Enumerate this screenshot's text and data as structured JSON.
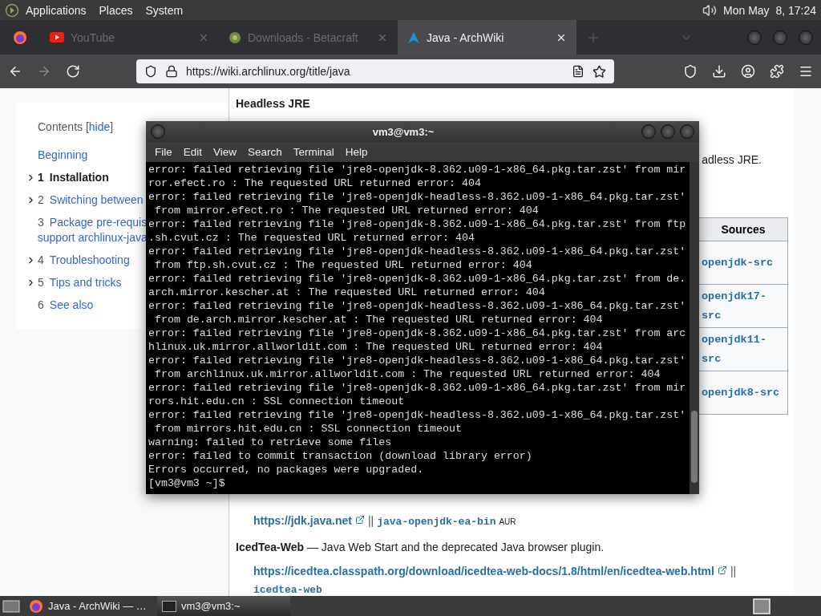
{
  "top_panel": {
    "menus": [
      "Applications",
      "Places",
      "System"
    ],
    "clock": "Mon May  8, 17:24"
  },
  "browser": {
    "tabs": [
      {
        "title": "YouTube",
        "kind": "youtube",
        "selected": false
      },
      {
        "title": "Downloads - Betacraft",
        "kind": "betacraft",
        "selected": false
      },
      {
        "title": "Java - ArchWiki",
        "kind": "arch",
        "selected": true
      }
    ],
    "url": "https://wiki.archlinux.org/title/java",
    "forward_disabled": true
  },
  "toc": {
    "title": "Contents",
    "bracket_open": "[",
    "toggle": "hide",
    "bracket_close": "]",
    "items": [
      {
        "lines": [
          "Beginning"
        ],
        "has_children": false,
        "selected": false
      },
      {
        "number": "1",
        "lines": [
          "Installation"
        ],
        "has_children": true,
        "selected": true
      },
      {
        "number": "2",
        "lines": [
          "Switching between"
        ],
        "has_children": true,
        "selected": false
      },
      {
        "number": "3",
        "lines": [
          "Package pre-requis",
          "support archlinux-java"
        ],
        "has_children": false,
        "selected": false
      },
      {
        "number": "4",
        "lines": [
          "Troubleshooting"
        ],
        "has_children": true,
        "selected": false
      },
      {
        "number": "5",
        "lines": [
          "Tips and tricks"
        ],
        "has_children": true,
        "selected": false
      },
      {
        "number": "6",
        "lines": [
          "See also"
        ],
        "has_children": false,
        "selected": false
      }
    ]
  },
  "article": {
    "heading": "Headless JRE",
    "fragment": "adless JRE.",
    "table": {
      "column": "Sources",
      "rows": [
        "openjdk-src",
        "openjdk17-src",
        "openjdk11-src",
        "openjdk8-src"
      ]
    },
    "ea_links": {
      "url": "https://jdk.java.net",
      "separator": "||",
      "package": "java-openjdk-ea-bin",
      "badge": "AUR"
    },
    "icedtea": {
      "description": "**IcedTea-Web** — Java Web Start and the deprecated Java browser plugin.",
      "url": "https://icedtea.classpath.org/download/icedtea-web-docs/1.8/html/en/icedtea-web.html",
      "separator": "||",
      "package": "icedtea-web"
    }
  },
  "terminal": {
    "title": "vm3@vm3:~",
    "menus": [
      "File",
      "Edit",
      "View",
      "Search",
      "Terminal",
      "Help"
    ],
    "lines": [
      "error: failed retrieving file 'jre8-openjdk-8.362.u09-1-x86_64.pkg.tar.zst' from mir",
      "ror.efect.ro : The requested URL returned error: 404",
      "error: failed retrieving file 'jre8-openjdk-headless-8.362.u09-1-x86_64.pkg.tar.zst'",
      " from mirror.efect.ro : The requested URL returned error: 404",
      "error: failed retrieving file 'jre8-openjdk-8.362.u09-1-x86_64.pkg.tar.zst' from ftp",
      ".sh.cvut.cz : The requested URL returned error: 404",
      "error: failed retrieving file 'jre8-openjdk-headless-8.362.u09-1-x86_64.pkg.tar.zst'",
      " from ftp.sh.cvut.cz : The requested URL returned error: 404",
      "error: failed retrieving file 'jre8-openjdk-8.362.u09-1-x86_64.pkg.tar.zst' from de.",
      "arch.mirror.kescher.at : The requested URL returned error: 404",
      "error: failed retrieving file 'jre8-openjdk-headless-8.362.u09-1-x86_64.pkg.tar.zst'",
      " from de.arch.mirror.kescher.at : The requested URL returned error: 404",
      "error: failed retrieving file 'jre8-openjdk-8.362.u09-1-x86_64.pkg.tar.zst' from arc",
      "hlinux.uk.mirror.allworldit.com : The requested URL returned error: 404",
      "error: failed retrieving file 'jre8-openjdk-headless-8.362.u09-1-x86_64.pkg.tar.zst'",
      " from archlinux.uk.mirror.allworldit.com : The requested URL returned error: 404",
      "error: failed retrieving file 'jre8-openjdk-8.362.u09-1-x86_64.pkg.tar.zst' from mir",
      "rors.hit.edu.cn : SSL connection timeout",
      "error: failed retrieving file 'jre8-openjdk-headless-8.362.u09-1-x86_64.pkg.tar.zst'",
      " from mirrors.hit.edu.cn : SSL connection timeout",
      "warning: failed to retrieve some files",
      "error: failed to commit transaction (download library error)",
      "Errors occurred, no packages were upgraded.",
      "[vm3@vm3 ~]$"
    ]
  },
  "taskbar": {
    "items": [
      {
        "label": "Java - ArchWiki — …",
        "kind": "browser",
        "selected": false
      },
      {
        "label": "vm3@vm3:~",
        "kind": "terminal",
        "selected": true
      }
    ]
  }
}
